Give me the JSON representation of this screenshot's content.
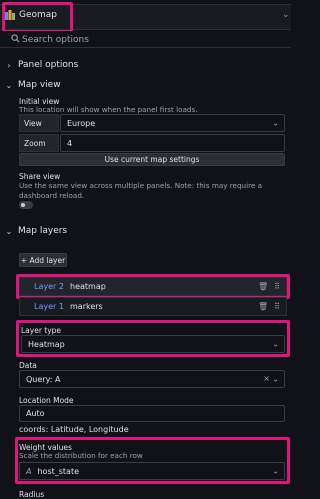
{
  "viz_picker": {
    "label": "Geomap"
  },
  "search": {
    "placeholder": "Search options"
  },
  "panel_options": {
    "title": "Panel options"
  },
  "map_view": {
    "title": "Map view",
    "initial_view": {
      "label": "Initial view",
      "description": "This location will show when the panel first loads.",
      "view_label": "View",
      "view_value": "Europe",
      "zoom_label": "Zoom",
      "zoom_value": "4",
      "use_current_button": "Use current map settings"
    },
    "share_view": {
      "label": "Share view",
      "description": "Use the same view across multiple panels. Note: this may require a dashboard reload.",
      "enabled": false
    }
  },
  "map_layers": {
    "title": "Map layers",
    "add_layer_button": "+ Add layer",
    "layers": [
      {
        "name": "Layer 2",
        "value": "heatmap"
      },
      {
        "name": "Layer 1",
        "value": "markers"
      }
    ]
  },
  "layer_type": {
    "label": "Layer type",
    "value": "Heatmap"
  },
  "data": {
    "label": "Data",
    "value": "Query: A"
  },
  "location_mode": {
    "label": "Location Mode",
    "value": "Auto",
    "coords_text": "coords: Latitude, Longitude"
  },
  "weight_values": {
    "label": "Weight values",
    "description": "Scale the distribution for each row",
    "value": "host_state"
  },
  "radius": {
    "label": "Radius"
  },
  "colors": {
    "highlight": "#e0147a",
    "layer_link": "#6e9fff",
    "background": "#111217"
  }
}
